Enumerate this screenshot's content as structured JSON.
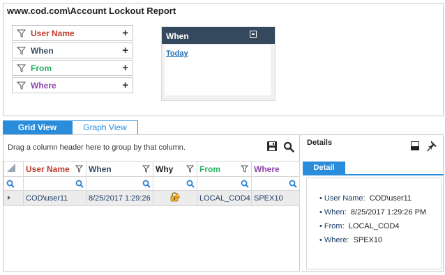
{
  "report": {
    "title": "www.cod.com\\Account Lockout Report"
  },
  "filters": [
    {
      "label": "User Name",
      "color": "#c0392b"
    },
    {
      "label": "When",
      "color": "#34495e"
    },
    {
      "label": "From",
      "color": "#27ae60"
    },
    {
      "label": "Where",
      "color": "#8e44ad"
    }
  ],
  "filter_add_symbol": "+",
  "when_panel": {
    "title": "When",
    "link": "Today"
  },
  "tabs": {
    "grid": "Grid View",
    "graph": "Graph View",
    "active": "Grid View"
  },
  "grid": {
    "group_hint": "Drag a column header here to group by that column.",
    "columns": [
      {
        "label": "User Name",
        "color": "#c0392b"
      },
      {
        "label": "When",
        "color": "#34495e"
      },
      {
        "label": "Why",
        "color": "#222222"
      },
      {
        "label": "From",
        "color": "#27ae60"
      },
      {
        "label": "Where",
        "color": "#8e44ad"
      }
    ],
    "rows": [
      {
        "user": "COD\\user11",
        "when": "8/25/2017 1:29:26",
        "why_icon": "lock-warning-icon",
        "from": "LOCAL_COD4",
        "where": "SPEX10"
      }
    ]
  },
  "details": {
    "title": "Details",
    "tab": "Detail",
    "items": [
      {
        "key": "User Name:",
        "value": "COD\\user11"
      },
      {
        "key": "When:",
        "value": "8/25/2017 1:29:26 PM"
      },
      {
        "key": "From:",
        "value": "LOCAL_COD4"
      },
      {
        "key": "Where:",
        "value": "SPEX10"
      }
    ]
  },
  "colors": {
    "accent": "#2a8ddc",
    "header_dark": "#34495e"
  }
}
